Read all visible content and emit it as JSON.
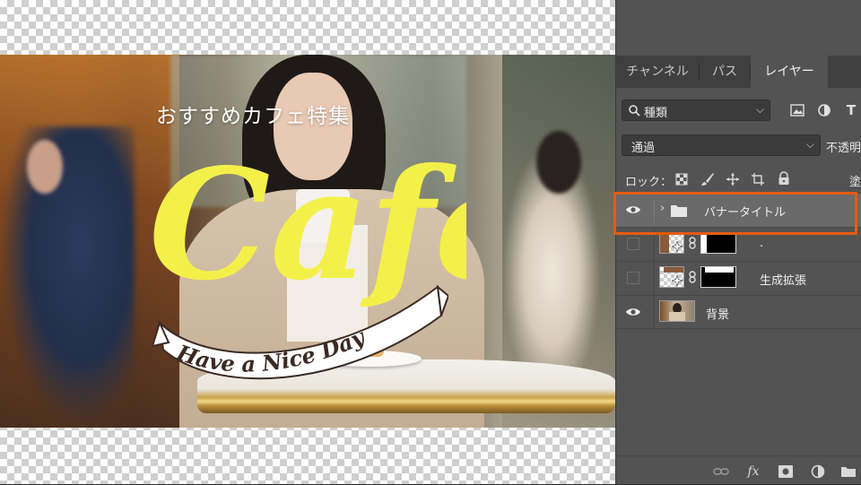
{
  "canvas": {
    "overline": "おすすめカフェ特集",
    "headline": "Cafe",
    "ribbon_text": "Have a Nice Day"
  },
  "panel": {
    "tabs": [
      {
        "label": "チャンネル"
      },
      {
        "label": "パス"
      },
      {
        "label": "レイヤー",
        "active": true
      }
    ],
    "filter": {
      "kind_label": "種類"
    },
    "blend_mode": "通過",
    "opacity_label": "不透明",
    "lock_label": "ロック：",
    "fill_label": "塗",
    "layers": [
      {
        "name": "バナータイトル",
        "type": "group",
        "visible": true,
        "selected": true
      },
      {
        "name": ".",
        "type": "masked",
        "visible": false
      },
      {
        "name": "生成拡張",
        "type": "masked",
        "visible": false
      },
      {
        "name": "背景",
        "type": "image",
        "visible": true
      }
    ]
  },
  "colors": {
    "headline": "#f4f04a",
    "highlight": "#e65c0a",
    "panel_bg": "#535353",
    "tabbar_bg": "#3f3f3f"
  }
}
